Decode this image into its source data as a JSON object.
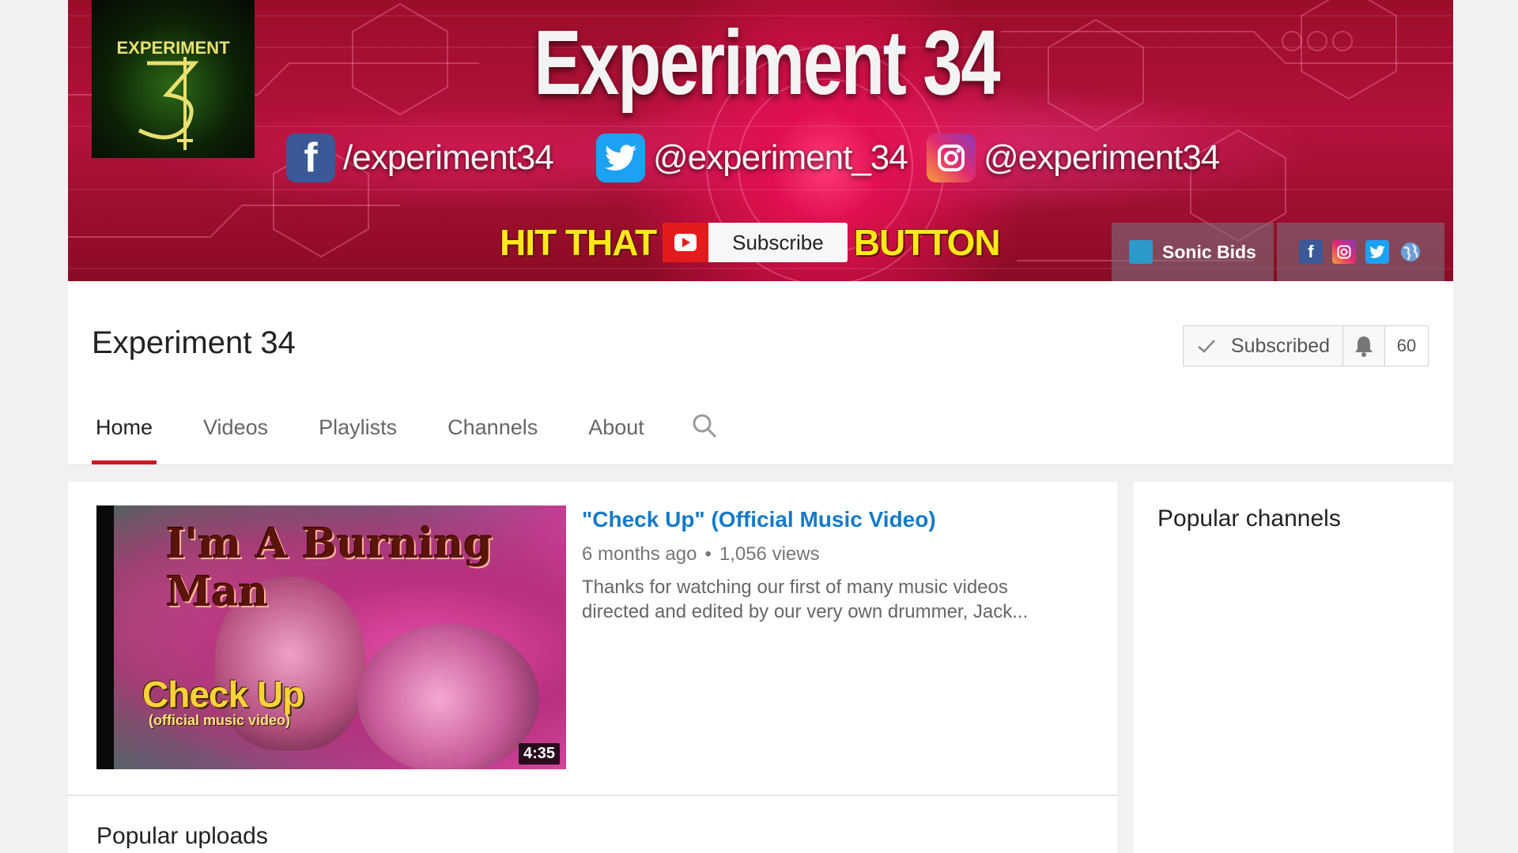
{
  "banner": {
    "logo_text": "EXPERIMENT",
    "title": "Experiment 34",
    "facebook": "/experiment34",
    "twitter": "@experiment_34",
    "instagram": "@experiment34",
    "hit_left": "HIT THAT",
    "hit_right": "BUTTON",
    "subscribe_graphic_label": "Subscribe",
    "link_sonic_bids": "Sonic Bids"
  },
  "channel": {
    "name": "Experiment 34",
    "subscribed_label": "Subscribed",
    "subscriber_count": "60"
  },
  "tabs": [
    {
      "label": "Home",
      "active": true
    },
    {
      "label": "Videos"
    },
    {
      "label": "Playlists"
    },
    {
      "label": "Channels"
    },
    {
      "label": "About"
    }
  ],
  "featured_video": {
    "title": "\"Check Up\" (Official Music Video)",
    "age": "6 months ago",
    "views": "1,056 views",
    "description_line1": "Thanks for watching our first of many music videos",
    "description_line2": "directed and edited by our very own drummer, Jack...",
    "duration": "4:35",
    "thumb_title": "I'm A Burning Man",
    "thumb_checkup": "Check Up",
    "thumb_sub": "(official music video)"
  },
  "sections": {
    "popular_uploads": "Popular uploads",
    "popular_channels": "Popular channels"
  },
  "colors": {
    "link_blue": "#167ac6",
    "tab_underline": "#cc181e",
    "banner_red": "#b3123a"
  }
}
